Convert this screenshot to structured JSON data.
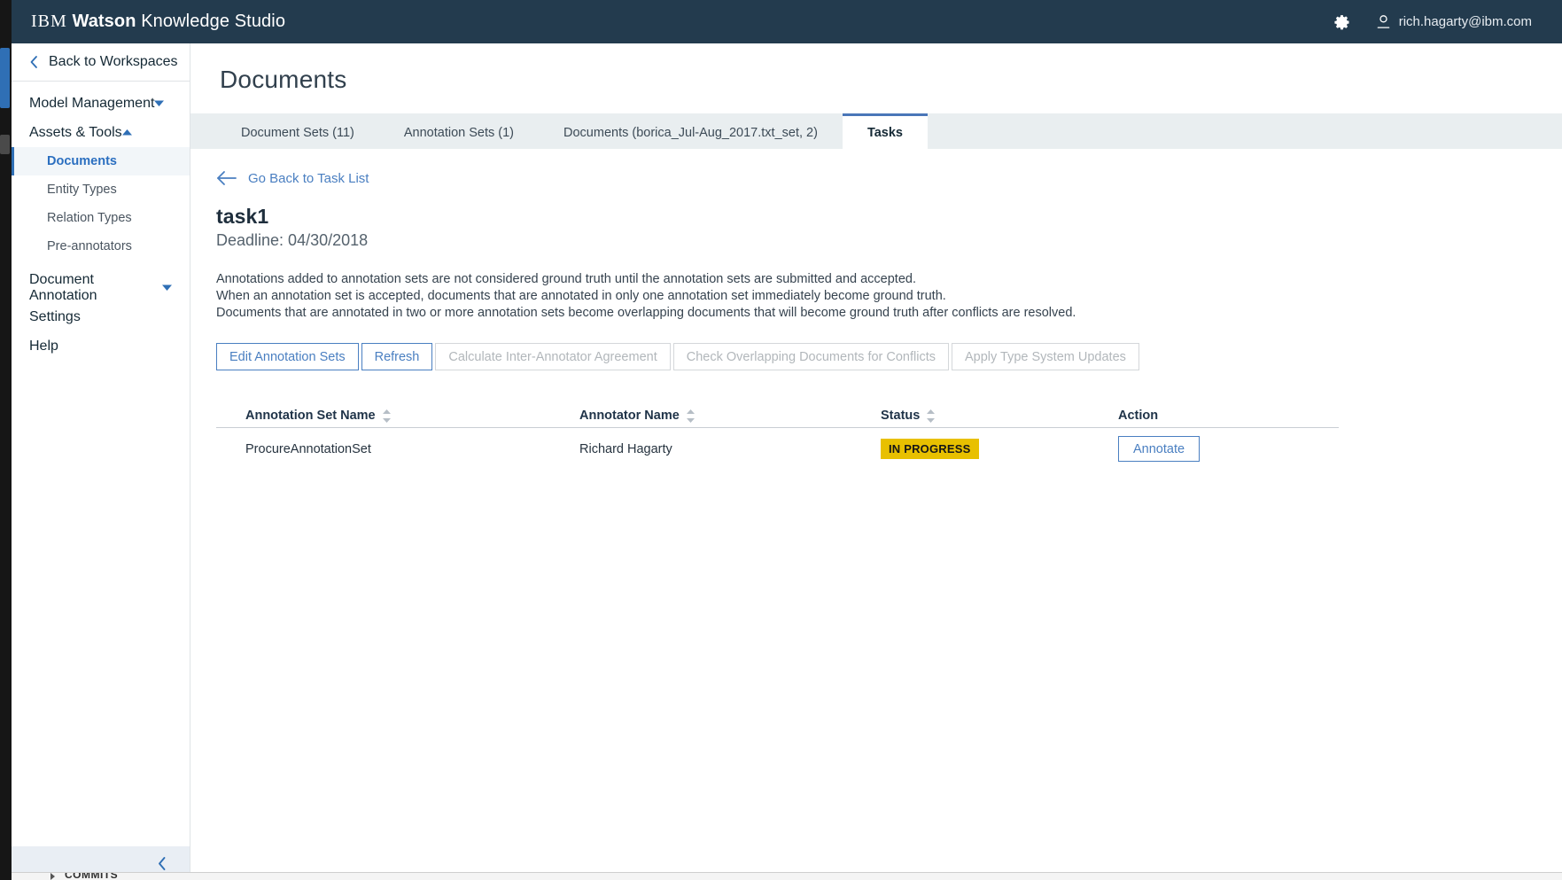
{
  "topbar": {
    "brand_prefix": "IBM",
    "brand_bold": "Watson",
    "brand_suffix": "Knowledge Studio",
    "settings_icon": "gear-icon",
    "user_icon": "person-icon",
    "user_email": "rich.hagarty@ibm.com"
  },
  "sidebar": {
    "back_label": "Back to Workspaces",
    "back_icon": "chevron-left-icon",
    "groups": [
      {
        "label": "Model Management",
        "expanded": false,
        "caret": "chevron-down-icon"
      },
      {
        "label": "Assets & Tools",
        "expanded": true,
        "caret": "chevron-up-icon"
      }
    ],
    "items": [
      {
        "label": "Documents",
        "selected": true
      },
      {
        "label": "Entity Types",
        "selected": false
      },
      {
        "label": "Relation Types",
        "selected": false
      },
      {
        "label": "Pre-annotators",
        "selected": false
      }
    ],
    "group2": {
      "label": "Document Annotation",
      "caret": "chevron-down-icon"
    },
    "links": [
      {
        "label": "Settings"
      },
      {
        "label": "Help"
      }
    ],
    "collapse_icon": "chevron-left-icon"
  },
  "main": {
    "page_title": "Documents",
    "tabs": [
      {
        "label": "Document Sets (11)",
        "active": false
      },
      {
        "label": "Annotation Sets (1)",
        "active": false
      },
      {
        "label": "Documents (borica_Jul-Aug_2017.txt_set, 2)",
        "active": false
      },
      {
        "label": "Tasks",
        "active": true
      }
    ],
    "back_link": "Go Back to Task List",
    "back_link_icon": "arrow-left-icon",
    "task_name": "task1",
    "deadline": "Deadline: 04/30/2018",
    "description_lines": [
      "Annotations added to annotation sets are not considered ground truth until the annotation sets are submitted and accepted.",
      "When an annotation set is accepted, documents that are annotated in only one annotation set immediately become ground truth.",
      "Documents that are annotated in two or more annotation sets become overlapping documents that will become ground truth after conflicts are resolved."
    ],
    "buttons": [
      {
        "label": "Edit Annotation Sets",
        "enabled": true
      },
      {
        "label": "Refresh",
        "enabled": true
      },
      {
        "label": "Calculate Inter-Annotator Agreement",
        "enabled": false
      },
      {
        "label": "Check Overlapping Documents for Conflicts",
        "enabled": false
      },
      {
        "label": "Apply Type System Updates",
        "enabled": false
      }
    ],
    "table": {
      "headers": [
        {
          "label": "Annotation Set Name",
          "sortable": true,
          "sort_icon": "sort-updown-icon"
        },
        {
          "label": "Annotator Name",
          "sortable": true,
          "sort_icon": "sort-updown-icon"
        },
        {
          "label": "Status",
          "sortable": true,
          "sort_icon": "sort-updown-icon"
        },
        {
          "label": "Action",
          "sortable": false
        }
      ],
      "rows": [
        {
          "annotation_set_name": "ProcureAnnotationSet",
          "annotator_name": "Richard Hagarty",
          "status": "IN PROGRESS",
          "action_label": "Annotate"
        }
      ]
    }
  },
  "bottom_stub": {
    "label": "COMMITS"
  },
  "colors": {
    "header_bg": "#233b4e",
    "accent_blue": "#4a7fc1",
    "selected_blue": "#2b6fc0",
    "status_yellow": "#e8c000",
    "tab_bar_bg": "#e9eef0"
  }
}
